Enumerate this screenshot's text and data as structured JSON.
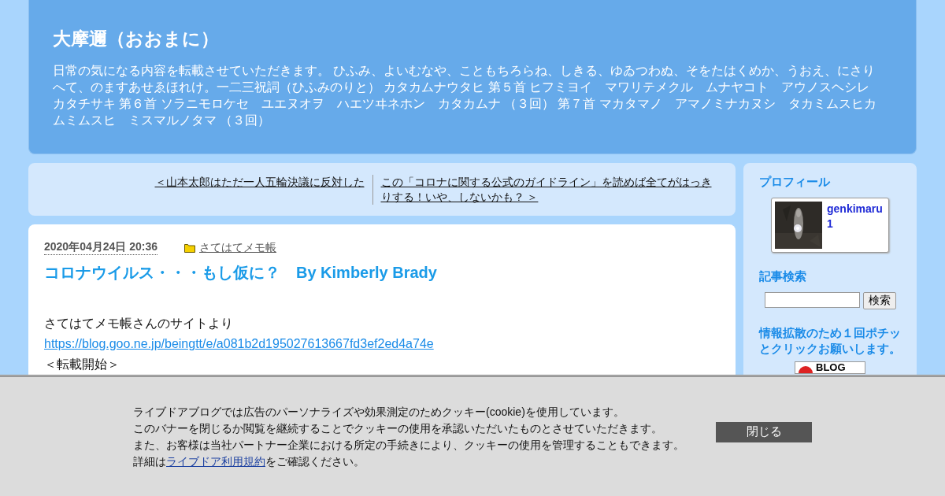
{
  "header": {
    "title": "大摩邇（おおまに）",
    "description": "日常の気になる内容を転載させていただきます。 ひふみ、よいむなや、こともちろらね、しきる、ゆゐつわぬ、そをたはくめか、うおえ、にさりへて、のますあせゑほれけ。一二三祝詞（ひふみのりと） カタカムナウタヒ 第５首 ヒフミヨイ　マワリテメクル　ムナヤコト　アウノスヘシレカタチサキ 第６首 ソラニモロケセ　ユエヌオヲ　ハエツヰネホン　カタカムナ （３回） 第７首 マカタマノ　アマノミナカヌシ　タカミムスヒカムミムスヒ　ミスマルノタマ （３回）"
  },
  "post_nav": {
    "previous": "＜山本太郎はただ一人五輪決議に反対した",
    "next": "この「コロナに関する公式のガイドライン」を読めば全てがはっきりする！いや、しないかも？ ＞"
  },
  "post": {
    "date": "2020年04月24日 20:36",
    "category": "さてはてメモ帳",
    "title": "コロナウイルス・・・もし仮に？　By Kimberly Brady",
    "lines": [
      {
        "kind": "text",
        "text": "さてはてメモ帳さんのサイトより"
      },
      {
        "kind": "link",
        "text": "https://blog.goo.ne.jp/beingtt/e/a081b2d195027613667fd3ef2ed4a74e"
      },
      {
        "kind": "text",
        "text": "＜転載開始＞"
      }
    ]
  },
  "sidebar": {
    "profile_heading": "プロフィール",
    "profile_name": "genkimaru1",
    "search_heading": "記事検索",
    "search_button": "検索",
    "ranking_heading": "情報拡散のため１回ポチッとクリックお願いします。",
    "ranking_banner": "BLOG"
  },
  "cookie_banner": {
    "lines": [
      "ライブドアブログでは広告のパーソナライズや効果測定のためクッキー(cookie)を使用しています。",
      "このバナーを閉じるか閲覧を継続することでクッキーの使用を承認いただいたものとさせていただきます。",
      "また、お客様は当社パートナー企業における所定の手続きにより、クッキーの使用を管理することもできます。"
    ],
    "last_line_before": "詳細は",
    "last_line_link": "ライブドア利用規約",
    "last_line_after": "をご確認ください。",
    "close_button": "閉じる"
  }
}
